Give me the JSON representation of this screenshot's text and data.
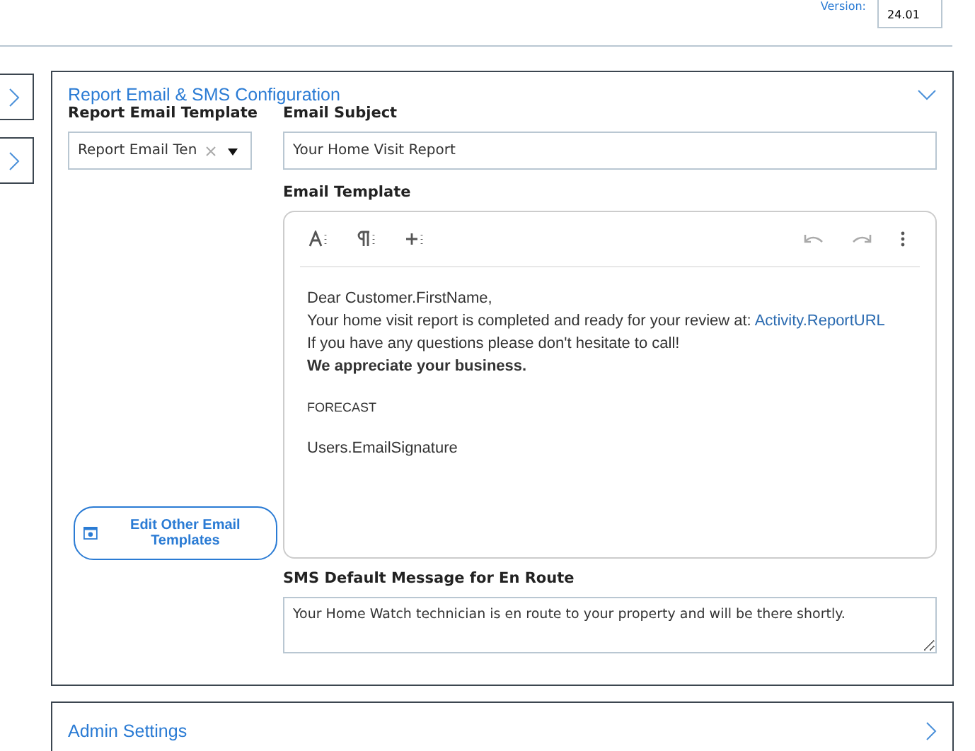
{
  "header": {
    "version_label": "Version:",
    "version_value": "24.01"
  },
  "email_panel": {
    "title": "Report Email & SMS Configuration",
    "expanded": true,
    "template_label": "Report Email Template",
    "template_value": "Report Email Ten",
    "subject_label": "Email Subject",
    "subject_value": "Your Home Visit Report",
    "editor_label": "Email Template",
    "editor_lines": [
      {
        "kind": "normal",
        "text": "Dear Customer.FirstName,"
      },
      {
        "kind": "link",
        "text": "Your home visit report is completed and ready for your review at: ",
        "link": "Activity.ReportURL"
      },
      {
        "kind": "normal",
        "text": "If you have any questions please don't hesitate to call!"
      },
      {
        "kind": "bold",
        "text": "We appreciate your business."
      },
      {
        "kind": "small",
        "text": "FORECAST"
      },
      {
        "kind": "normal",
        "text": "Users.EmailSignature"
      }
    ],
    "edit_button": "Edit  Other  Email Templates",
    "sms_label": "SMS Default Message for En Route",
    "sms_value": "Your Home Watch technician is en route to your property and will be there shortly."
  },
  "admin_panel": {
    "title": "Admin Settings",
    "expanded": false
  }
}
